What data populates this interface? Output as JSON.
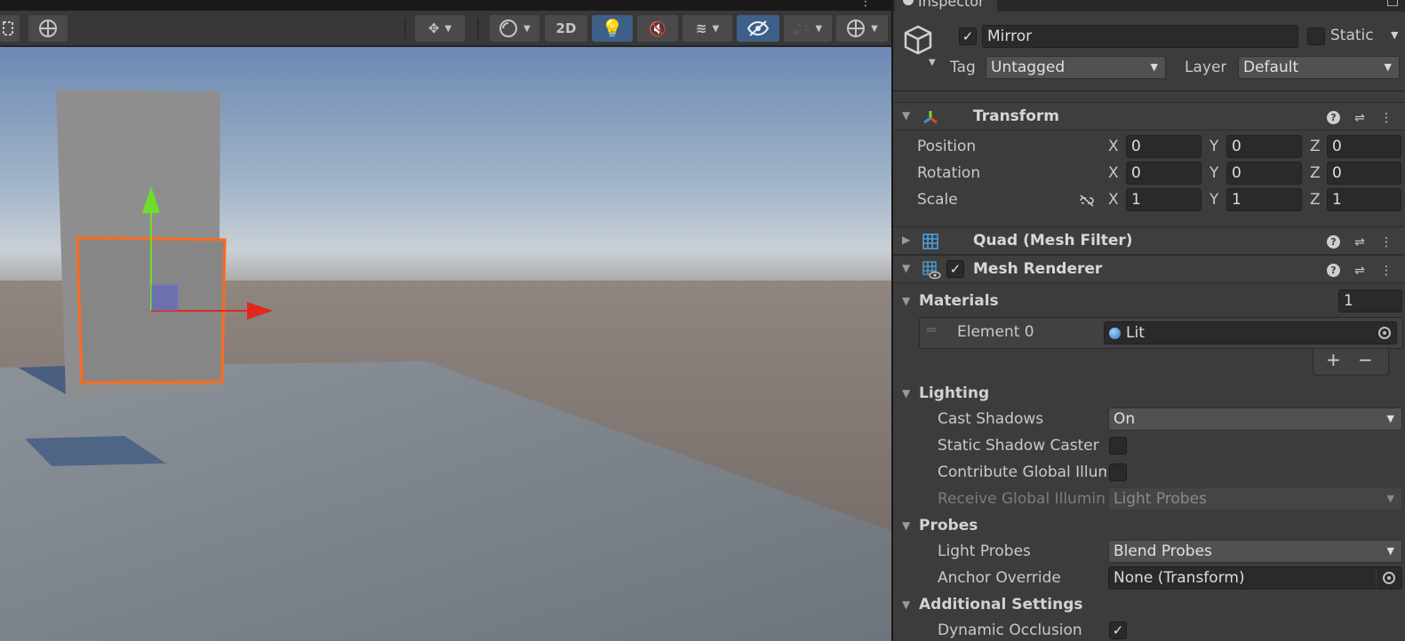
{
  "scene_toolbar": {
    "toggle_2d_label": "2D"
  },
  "inspector": {
    "tab_label": "Inspector",
    "gameobject": {
      "active": true,
      "name": "Mirror",
      "static_label": "Static",
      "static_checked": false,
      "tag_label": "Tag",
      "tag_value": "Untagged",
      "layer_label": "Layer",
      "layer_value": "Default"
    },
    "transform": {
      "title": "Transform",
      "position_label": "Position",
      "rotation_label": "Rotation",
      "scale_label": "Scale",
      "x_label": "X",
      "y_label": "Y",
      "z_label": "Z",
      "position": {
        "x": "0",
        "y": "0",
        "z": "0"
      },
      "rotation": {
        "x": "0",
        "y": "0",
        "z": "0"
      },
      "scale": {
        "x": "1",
        "y": "1",
        "z": "1"
      }
    },
    "mesh_filter": {
      "title": "Quad (Mesh Filter)"
    },
    "mesh_renderer": {
      "title": "Mesh Renderer",
      "enabled": true,
      "materials_label": "Materials",
      "materials_count": "1",
      "element_label": "Element 0",
      "element_value": "Lit",
      "add_symbol": "+",
      "remove_symbol": "−",
      "lighting_label": "Lighting",
      "cast_shadows_label": "Cast Shadows",
      "cast_shadows_value": "On",
      "static_shadow_caster_label": "Static Shadow Caster",
      "contribute_gi_label": "Contribute Global Illumination",
      "receive_gi_label": "Receive Global Illumination",
      "receive_gi_value": "Light Probes",
      "probes_label": "Probes",
      "light_probes_label": "Light Probes",
      "light_probes_value": "Blend Probes",
      "anchor_override_label": "Anchor Override",
      "anchor_override_value": "None (Transform)",
      "additional_settings_label": "Additional Settings",
      "dynamic_occlusion_label": "Dynamic Occlusion",
      "dynamic_occlusion_checked": true
    }
  },
  "colors": {
    "selection_outline": "#ff6a1a",
    "gizmo_x": "#e0281e",
    "gizmo_y": "#6ede2a",
    "toolbar_active": "#3e5f87",
    "panel_bg": "#3c3c3c"
  }
}
